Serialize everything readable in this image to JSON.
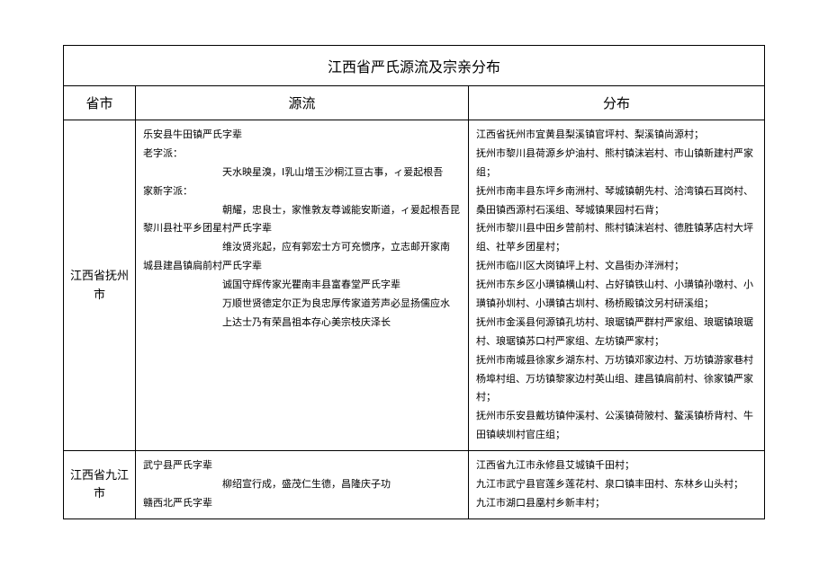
{
  "title": "江西省严氏源流及宗亲分布",
  "headers": {
    "region": "省市",
    "yuanliu": "源流",
    "fenbu": "分布"
  },
  "rows": [
    {
      "region": "江西省抚州市",
      "yuanliu_lines": [
        "乐安县牛田镇严氏字辈",
        "老字派：",
        "　　　　　　　　天水映星溴，Ⅰ乳山增玉沙桐江亘古事，ィ爰起根吾",
        "家新字派：",
        "　　　　　　　　朝耀，忠良士，家惟敦友尊诚能安斯道，ィ爰起根吾昆",
        "黎川县社平乡团星村严氏字辈",
        "　　　　　　　　维汝贤兆起，应有郭宏士方可充惯序，立志邮开家南",
        "城县建昌镇扃前村严氏字辈",
        "　　　　　　　　诚国守辉传家光瞿南丰县富春堂严氏字辈",
        "　　　　　　　　万顺世贤德定尔正为良忠厚传家道芳声必显扬儒应水",
        "　　　　　　　　上达士乃有荣昌祖本存心美宗枝庆泽长"
      ],
      "fenbu_lines": [
        "江西省抚州市宜黄县梨溪镇官坪村、梨溪镇尚源村；",
        "抚州市黎川县荷源乡炉油村、熊村镇沫岩村、市山镇新建村严家组；",
        "抚州市南丰县东坪乡南洲村、琴城镇朝先村、洽湾镇石耳岗村、桑田镇西源村石溪组、琴城镇果园村石背；",
        "抚州市黎川县中田乡营前村、熊村镇沫岩村、德胜镇茅店村大坪组、社苹乡团星村；",
        "抚州市临川区大岗镇坪上村、文昌街办洋洲村；",
        "抚州市东乡区小璜镇横山村、占好镇铁山村、小璜镇孙墩村、小璜镇孙圳村、小璜镇古圳村、杨桥殿镇汶另村研溪组；",
        "抚州市金溪县何源镇孔坊村、琅琚镇严群村严家组、琅琚镇琅琚村、琅琚镇苏口村严家组、左坊镇严家村；",
        "抚州市南城县徐家乡湖东村、万坊镇邓家边村、万坊镇游家巷村杨埠村组、万坊镇黎家边村英山组、建昌镇扃前村、徐家镇严家村；",
        "抚州市乐安县戴坊镇仲溪村、公溪镇荷陂村、鳌溪镇桥背村、牛田镇峡圳村官庄组；"
      ]
    },
    {
      "region": "江西省九江市",
      "yuanliu_lines": [
        "武宁县严氏字辈",
        "　　　　　　　　柳绍宣行成，盛茂仁生德，昌隆庆子功",
        "赣西北严氏字辈"
      ],
      "fenbu_lines": [
        "江西省九江市永修县艾城镇千田村；",
        "九江市武宁县官莲乡莲花村、泉口镇丰田村、东林乡山头村；",
        "九江市湖口县凰村乡新丰村；"
      ]
    }
  ]
}
